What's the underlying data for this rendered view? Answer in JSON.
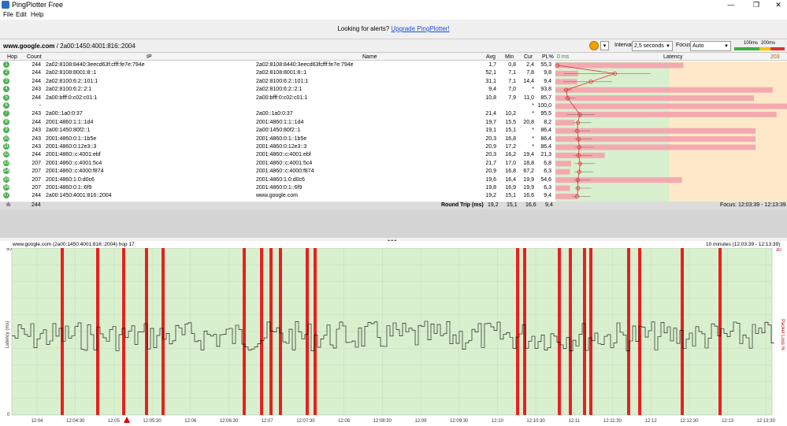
{
  "window": {
    "title": "PingPlotter Free",
    "minimize": "—",
    "maximize": "❐",
    "close": "✕"
  },
  "menu": [
    "File",
    "Edit",
    "Help"
  ],
  "alert": {
    "text": "Looking for alerts? ",
    "link": "Upgrade PingPlotter!"
  },
  "toolbar": {
    "target_name": "www.google.com",
    "target_ip": " / 2a00:1450:4001:816::2004",
    "interval_label": "Interval",
    "interval_value": "2,5 seconds",
    "focus_label": "Focus",
    "focus_value": "Auto",
    "scale_100": "100ms",
    "scale_200": "200ms"
  },
  "table": {
    "headers": {
      "hop": "Hop",
      "count": "Count",
      "ip": "IP",
      "name": "Name",
      "avg": "Avg",
      "min": "Min",
      "cur": "Cur",
      "pl": "PL%",
      "zero": "0 ms",
      "latency": "Latency",
      "max": "203 ms"
    },
    "rows": [
      {
        "hop": "1",
        "count": "244",
        "ip": "2a02:8108:8440:3eecd63f:cfff:fe7e:794e",
        "name": "2a02:8108:8440:3eecd63fcfff:fe7e:794e",
        "avg": "1,7",
        "min": "0,8",
        "cur": "2,4",
        "pl": "55,3"
      },
      {
        "hop": "2",
        "count": "244",
        "ip": "2a02:8108:8001:8::1",
        "name": "2a02:8108:8001:8::1",
        "avg": "52,1",
        "min": "7,1",
        "cur": "7,8",
        "pl": "9,8"
      },
      {
        "hop": "3",
        "count": "244",
        "ip": "2a02:8100:6:2::101:1",
        "name": "2a02:8100:6:2::101:1",
        "avg": "31,1",
        "min": "7,1",
        "cur": "14,4",
        "pl": "9,4"
      },
      {
        "hop": "4",
        "count": "243",
        "ip": "2a02:8100:6:2::2:1",
        "name": "2a02:8100:6:2::2:1",
        "avg": "9,4",
        "min": "7,0",
        "cur": "*",
        "pl": "93,8"
      },
      {
        "hop": "5",
        "count": "244",
        "ip": "2a00:bfff:0:c02:c01:1",
        "name": "2a00:bfff:0:c02:c01:1",
        "avg": "10,8",
        "min": "7,9",
        "cur": "11,0",
        "pl": "85,7"
      },
      {
        "hop": "6",
        "count": "-",
        "ip": "",
        "name": "",
        "avg": "",
        "min": "",
        "cur": "*",
        "pl": "100,0"
      },
      {
        "hop": "7",
        "count": "243",
        "ip": "2a00::1a0:0:37",
        "name": "2a00::1a0:0:37",
        "avg": "21,4",
        "min": "10,2",
        "cur": "*",
        "pl": "95,5"
      },
      {
        "hop": "8",
        "count": "244",
        "ip": "2001:4860:1:1::1d4",
        "name": "2001:4860:1:1::1d4",
        "avg": "19,7",
        "min": "15,5",
        "cur": "20,8",
        "pl": "8,2"
      },
      {
        "hop": "9",
        "count": "243",
        "ip": "2a00:1450:80f2::1",
        "name": "2a00:1450:80f2::1",
        "avg": "19,1",
        "min": "15,1",
        "cur": "*",
        "pl": "86,4"
      },
      {
        "hop": "10",
        "count": "243",
        "ip": "2001:4860:0:1::1b5e",
        "name": "2001:4860:0:1::1b5e",
        "avg": "20,3",
        "min": "16,8",
        "cur": "*",
        "pl": "86,4"
      },
      {
        "hop": "11",
        "count": "243",
        "ip": "2001:4860:0:12e3::3",
        "name": "2001:4860:0:12e3::3",
        "avg": "20,9",
        "min": "17,2",
        "cur": "*",
        "pl": "86,4"
      },
      {
        "hop": "12",
        "count": "244",
        "ip": "2001:4860::c:4001:ebf",
        "name": "2001:4860::c:4001:ebf",
        "avg": "20,3",
        "min": "16,2",
        "cur": "19,4",
        "pl": "21,3"
      },
      {
        "hop": "13",
        "count": "207",
        "ip": "2001:4860::c:4001:5c4",
        "name": "2001:4860::c:4001:5c4",
        "avg": "21,7",
        "min": "17,0",
        "cur": "18,8",
        "pl": "6,8"
      },
      {
        "hop": "14",
        "count": "207",
        "ip": "2001:4860::c:4000:f874",
        "name": "2001:4860::c:4000:f874",
        "avg": "20,9",
        "min": "16,8",
        "cur": "67,2",
        "pl": "6,3"
      },
      {
        "hop": "15",
        "count": "207",
        "ip": "2001:4860:1:0:d0c6",
        "name": "2001:4860:1:0:d0c6",
        "avg": "19,6",
        "min": "16,4",
        "cur": "19,9",
        "pl": "54,6"
      },
      {
        "hop": "16",
        "count": "207",
        "ip": "2001:4860:0:1::6f9",
        "name": "2001:4860:0:1::6f9",
        "avg": "19,8",
        "min": "16,9",
        "cur": "19,9",
        "pl": "6,3"
      },
      {
        "hop": "17",
        "count": "244",
        "ip": "2a00:1450:4001:816::2004",
        "name": "www.google.com",
        "avg": "19,2",
        "min": "15,1",
        "cur": "16,6",
        "pl": "9,4"
      }
    ],
    "total": {
      "count": "244",
      "label": "Round Trip (ms)",
      "avg": "19,2",
      "min": "15,1",
      "cur": "16,6",
      "pl": "9,4",
      "focus": "Focus: 12:03:39 - 12:13:39"
    }
  },
  "lower": {
    "left_title": "www.google.com (2a00:1450:4001:816::2004) hop 17",
    "right_title": "10 minutes (12:03:39 - 12:13:39)",
    "y_label_left": "Latency (ms)",
    "y_label_right": "Packet Loss %",
    "y_top_left": "50",
    "y_top_right": "30",
    "y_bottom_left": "0",
    "x_ticks": [
      "12:04",
      "12:04:30",
      "12:05",
      "12:05:30",
      "12:06",
      "12:06:30",
      "12:07",
      "12:07:30",
      "12:08",
      "12:08:30",
      "12:09",
      "12:09:30",
      "12:10",
      "12:10:30",
      "12:11",
      "12:11:30",
      "12:12",
      "12:12:30",
      "12:13",
      "12:13:30"
    ]
  },
  "colors": {
    "loss_bar": "#e82020",
    "green_zone": "#d9f0cf",
    "orange_zone": "#fde9c9",
    "hop_badge": "#4caf50",
    "avg_line": "#e03030"
  }
}
